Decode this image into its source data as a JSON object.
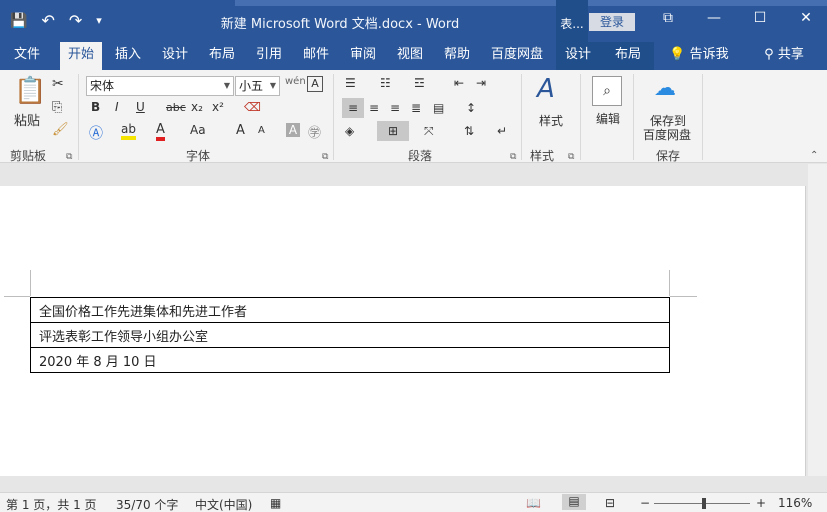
{
  "window": {
    "title": "新建 Microsoft Word 文档.docx  -  Word",
    "context_label": "表...",
    "login_label": "登录",
    "controls": [
      "⧉",
      "—",
      "☐",
      "✕"
    ]
  },
  "qat": {
    "save_icon": "💾",
    "undo_icon": "↶",
    "redo_icon": "↷",
    "customize_icon": "▾"
  },
  "tabs": [
    {
      "label": "文件"
    },
    {
      "label": "开始"
    },
    {
      "label": "插入"
    },
    {
      "label": "设计"
    },
    {
      "label": "布局"
    },
    {
      "label": "引用"
    },
    {
      "label": "邮件"
    },
    {
      "label": "审阅"
    },
    {
      "label": "视图"
    },
    {
      "label": "帮助"
    },
    {
      "label": "百度网盘"
    },
    {
      "label": "设计"
    },
    {
      "label": "布局"
    },
    {
      "label": "告诉我"
    },
    {
      "label": "共享"
    }
  ],
  "ribbon": {
    "clipboard": {
      "paste_label": "粘贴",
      "group_label": "剪贴板"
    },
    "font": {
      "font_name": "宋体",
      "font_size": "小五",
      "bold": "B",
      "italic": "I",
      "underline": "U",
      "strike": "abc",
      "subscript": "x₂",
      "superscript": "x²",
      "grow": "A",
      "shrink": "A",
      "case": "Aa",
      "group_label": "字体"
    },
    "paragraph": {
      "group_label": "段落"
    },
    "styles": {
      "label": "样式",
      "group_label": "样式"
    },
    "editing": {
      "label": "编辑"
    },
    "save": {
      "label_line1": "保存到",
      "label_line2": "百度网盘",
      "group_label": "保存"
    }
  },
  "document": {
    "rows": [
      "全国价格工作先进集体和先进工作者",
      "评选表彰工作领导小组办公室",
      "2020 年 8 月 10 日"
    ]
  },
  "status": {
    "page": "第 1 页，共 1 页",
    "words": "35/70 个字",
    "language": "中文(中国)",
    "zoom": "116%",
    "minus": "−",
    "plus": "+"
  }
}
